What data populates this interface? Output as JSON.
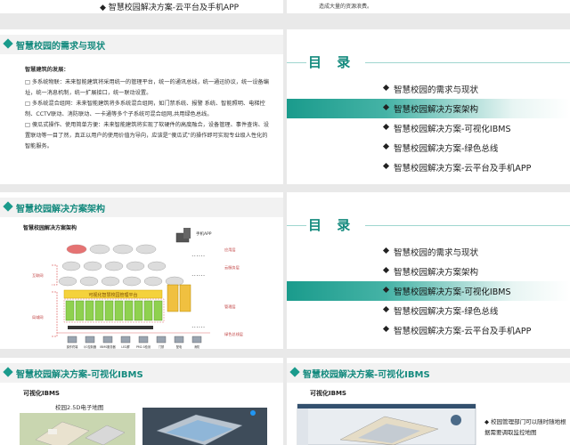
{
  "slide1": {
    "item": "智慧校园解决方案-云平台及手机APP"
  },
  "slide2": {
    "note": "造成大量的资源浪费。"
  },
  "slide3": {
    "header": "智慧校园的需求与现状",
    "subtitle": "智慧建筑的发展：",
    "paragraphs": [
      "多系统物联：未来智能建筑将采用统一的管理平台，统一的通讯总线，统一通迅协议，统一设备编址，统一消息机制，统一扩展接口，统一联动设置。",
      "多系统混合组网：未来智能建筑将多系统混合组网，如门禁系统、报警 系统、智能照明、电梯控制、CCTV联动、消防联动、一卡通等多个子系统可混合组网,共用绿色总线。",
      "傻瓜式操作、使用简单方便：未来智能建筑将实现了软硬件的高度融合，设备管理、事件查询、设置联动等一目了然，真正以用户的使用价值为导向，应该是“傻瓜式”的操作即可实现专业级人性化的智能服务。"
    ]
  },
  "toc": {
    "title": "目 录",
    "items": [
      "智慧校园的需求与现状",
      "智慧校园解决方案架构",
      "智慧校园解决方案-可视化IBMS",
      "智慧校园解决方案-绿色总线",
      "智慧校园解决方案-云平台及手机APP"
    ]
  },
  "slide5": {
    "header": "智慧校园解决方案架构",
    "diagram_title": "智慧校园解决方案架构",
    "left_labels": [
      "互联网",
      "局域网"
    ],
    "right_labels": [
      "应用层",
      "云服务层",
      "管理层",
      "绿色总线层"
    ],
    "platform_label": "可视化智慧校园管理平台",
    "top_label": "手机APP",
    "device_labels": [
      "操作终端",
      "I/O控制器",
      "IBMS服务器",
      "LED屏",
      "PM2.5检测",
      "门禁",
      "配电",
      "消防"
    ]
  },
  "slide7": {
    "header": "智慧校园解决方案-可视化IBMS",
    "label": "可视化IBMS",
    "caption": "校园2.5D电子地图"
  },
  "slide8": {
    "header": "智慧校园解决方案-可视化IBMS",
    "label": "可视化IBMS",
    "bullet": "校园管理部门可以随时随地根据需要调取监控地图"
  },
  "colors": {
    "accent": "#1a9b8c",
    "accent_dark": "#148a7e",
    "text": "#222222"
  }
}
